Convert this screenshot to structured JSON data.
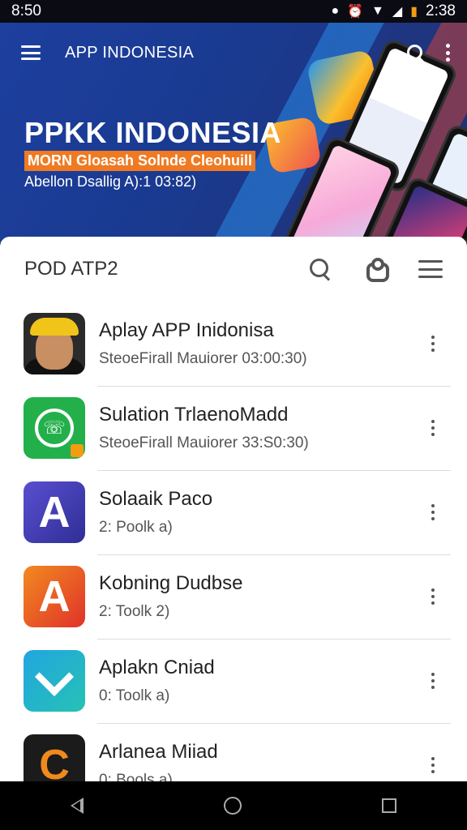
{
  "status_bar": {
    "time_left": "8:50",
    "time_right": "2:38"
  },
  "header": {
    "title": "APP INDONESIA",
    "headline": "PPKK INDONESIA",
    "subheadline": "MORN Gloasah Solnde Cleohuill",
    "subline": "Abellon Dsallig A):1 03:82)"
  },
  "list_section": {
    "title": "POD ATP2",
    "items": [
      {
        "title": "Aplay APP Inidonisa",
        "subtitle": "SteoeFirall Mauiorer 03:00:30)",
        "icon": "avatar-icon"
      },
      {
        "title": "Sulation TrlaenoMadd",
        "subtitle": "SteoeFirall Mauiorer 33:S0:30)",
        "icon": "chat-app-icon"
      },
      {
        "title": "Solaaik Paco",
        "subtitle": "2: Poolk  a)",
        "icon": "letter-a-purple-icon"
      },
      {
        "title": "Kobning Dudbse",
        "subtitle": "2: Toolk  2)",
        "icon": "letter-a-orange-icon"
      },
      {
        "title": "Aplakn Cniad",
        "subtitle": "0: Toolk  a)",
        "icon": "chevron-teal-icon"
      },
      {
        "title": "Arlanea Miiad",
        "subtitle": "0: Bools  a)",
        "icon": "letter-c-dark-icon"
      }
    ]
  }
}
